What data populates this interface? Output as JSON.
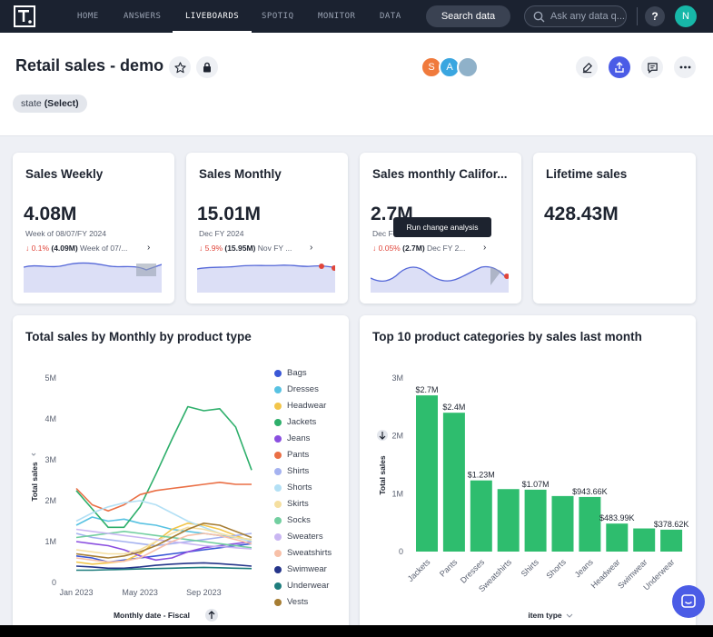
{
  "nav": {
    "tabs": [
      {
        "label": "HOME"
      },
      {
        "label": "ANSWERS"
      },
      {
        "label": "LIVEBOARDS"
      },
      {
        "label": "SPOTIQ"
      },
      {
        "label": "MONITOR"
      },
      {
        "label": "DATA"
      }
    ],
    "active_tab": "LIVEBOARDS",
    "search_button": "Search data",
    "ask_placeholder": "Ask any data q...",
    "help": "?",
    "user_initial": "N",
    "user_color": "#17b7a8"
  },
  "header": {
    "title": "Retail sales - demo",
    "collaborators": [
      {
        "initial": "S",
        "color": "#f07a3c"
      },
      {
        "initial": "A",
        "color": "#3aa6e0"
      },
      {
        "initial": "",
        "color": "#8fb1c9"
      }
    ],
    "filter": {
      "name": "state",
      "value": "(Select)"
    }
  },
  "kpis": [
    {
      "title": "Sales Weekly",
      "value": "4.08M",
      "period": "Week of 08/07/FY 2024",
      "change_pct": "0.1%",
      "change_abs": "(4.09M)",
      "compare": "Week of 07/..."
    },
    {
      "title": "Sales Monthly",
      "value": "15.01M",
      "period": "Dec FY 2024",
      "change_pct": "5.9%",
      "change_abs": "(15.95M)",
      "compare": "Nov FY ..."
    },
    {
      "title": "Sales monthly Califor...",
      "value": "2.7M",
      "period": "Dec FY 2024",
      "change_pct": "0.05%",
      "change_abs": "(2.7M)",
      "compare": "Dec FY 2..."
    },
    {
      "title": "Lifetime sales",
      "value": "428.43M"
    }
  ],
  "tooltip": "Run change analysis",
  "colors": {
    "accent": "#4b5ce6",
    "bar": "#2ebd6e",
    "negative": "#e0453a",
    "spark_fill": "#dcdff6",
    "spark_line": "#5467d8"
  },
  "line_chart": {
    "title": "Total sales by Monthly by product type",
    "xlabel": "Monthly date - Fiscal",
    "ylabel": "Total sales",
    "y_ticks": [
      "0",
      "1M",
      "2M",
      "3M",
      "4M",
      "5M"
    ],
    "x_ticks": [
      "Jan 2023",
      "May 2023",
      "Sep 2023"
    ]
  },
  "chart_data": [
    {
      "type": "line",
      "title": "Total sales by Monthly by product type",
      "xlabel": "Monthly date - Fiscal",
      "ylabel": "Total sales",
      "ylim": [
        0,
        5000000
      ],
      "x": [
        "Jan 2023",
        "Feb 2023",
        "Mar 2023",
        "Apr 2023",
        "May 2023",
        "Jun 2023",
        "Jul 2023",
        "Aug 2023",
        "Sep 2023",
        "Oct 2023",
        "Nov 2023",
        "Dec 2023"
      ],
      "legend_position": "right",
      "series": [
        {
          "name": "Bags",
          "color": "#3a57d6",
          "values": [
            650000,
            600000,
            500000,
            550000,
            600000,
            650000,
            700000,
            750000,
            800000,
            850000,
            900000,
            950000
          ]
        },
        {
          "name": "Dresses",
          "color": "#58c2e2",
          "values": [
            1400000,
            1600000,
            1500000,
            1550000,
            1450000,
            1400000,
            1300000,
            1250000,
            1200000,
            1150000,
            1100000,
            1050000
          ]
        },
        {
          "name": "Headwear",
          "color": "#f2c54a",
          "values": [
            500000,
            450000,
            480000,
            520000,
            700000,
            1000000,
            1300000,
            1450000,
            1400000,
            1300000,
            1150000,
            1000000
          ]
        },
        {
          "name": "Jackets",
          "color": "#2eaf6b",
          "values": [
            2250000,
            1800000,
            1350000,
            1350000,
            1850000,
            2650000,
            3500000,
            4300000,
            4200000,
            4250000,
            3800000,
            2750000
          ]
        },
        {
          "name": "Jeans",
          "color": "#8a4fe0",
          "values": [
            1000000,
            950000,
            900000,
            800000,
            650000,
            550000,
            600000,
            750000,
            850000,
            900000,
            950000,
            1000000
          ]
        },
        {
          "name": "Pants",
          "color": "#ea6f45",
          "values": [
            2300000,
            1900000,
            1750000,
            1900000,
            2150000,
            2250000,
            2300000,
            2350000,
            2400000,
            2450000,
            2400000,
            2400000
          ]
        },
        {
          "name": "Shirts",
          "color": "#a5b2f0",
          "values": [
            1200000,
            1100000,
            1050000,
            1000000,
            950000,
            900000,
            950000,
            1000000,
            1050000,
            1100000,
            1150000,
            1200000
          ]
        },
        {
          "name": "Shorts",
          "color": "#b3e0f5",
          "values": [
            1500000,
            1700000,
            1850000,
            1950000,
            2000000,
            1900000,
            1700000,
            1500000,
            1350000,
            1200000,
            1100000,
            1000000
          ]
        },
        {
          "name": "Skirts",
          "color": "#f5dfa0",
          "values": [
            800000,
            750000,
            700000,
            700000,
            800000,
            1000000,
            1200000,
            1350000,
            1300000,
            1200000,
            1100000,
            1050000
          ]
        },
        {
          "name": "Socks",
          "color": "#72cfa0",
          "values": [
            1100000,
            1150000,
            1200000,
            1250000,
            1200000,
            1150000,
            1100000,
            1050000,
            1000000,
            950000,
            900000,
            850000
          ]
        },
        {
          "name": "Sweaters",
          "color": "#c9b6f2",
          "values": [
            1300000,
            1250000,
            1200000,
            1150000,
            1100000,
            1050000,
            1000000,
            950000,
            900000,
            880000,
            850000,
            820000
          ]
        },
        {
          "name": "Sweatshirts",
          "color": "#f7c0a8",
          "values": [
            600000,
            550000,
            500000,
            520000,
            600000,
            800000,
            1000000,
            1150000,
            1200000,
            1150000,
            1050000,
            950000
          ]
        },
        {
          "name": "Swimwear",
          "color": "#25358a",
          "values": [
            400000,
            380000,
            350000,
            350000,
            380000,
            420000,
            450000,
            470000,
            480000,
            460000,
            430000,
            400000
          ]
        },
        {
          "name": "Underwear",
          "color": "#1e7d7d",
          "values": [
            300000,
            300000,
            310000,
            320000,
            330000,
            340000,
            350000,
            360000,
            370000,
            360000,
            350000,
            340000
          ]
        },
        {
          "name": "Vests",
          "color": "#a67d33",
          "values": [
            700000,
            650000,
            600000,
            650000,
            750000,
            900000,
            1100000,
            1300000,
            1450000,
            1400000,
            1250000,
            1100000
          ]
        }
      ]
    },
    {
      "type": "bar",
      "title": "Top 10 product categories by sales last month",
      "xlabel": "item type",
      "ylabel": "Total sales",
      "ylim": [
        0,
        3000000
      ],
      "y_ticks": [
        "0",
        "1M",
        "2M",
        "3M"
      ],
      "categories": [
        "Jackets",
        "Pants",
        "Dresses",
        "Sweatshirts",
        "Shirts",
        "Shorts",
        "Jeans",
        "Headwear",
        "Swimwear",
        "Underwear"
      ],
      "values": [
        2700000,
        2400000,
        1230000,
        1080000,
        1070000,
        960000,
        943660,
        483990,
        400000,
        378620
      ],
      "data_labels": [
        "$2.7M",
        "$2.4M",
        "$1.23M",
        "",
        "$1.07M",
        "",
        "$943.66K",
        "$483.99K",
        "",
        "$378.62K"
      ]
    }
  ]
}
